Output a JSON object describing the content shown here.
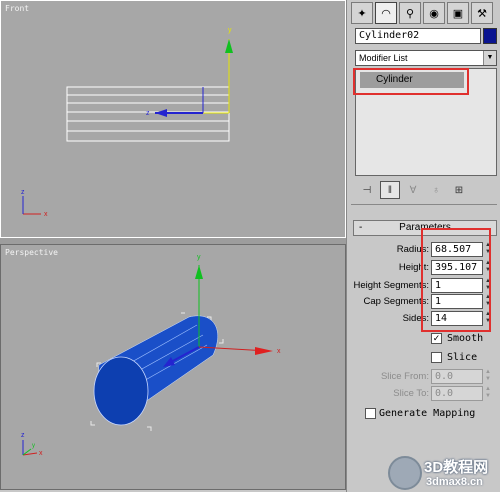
{
  "viewports": {
    "front": {
      "label": "Front"
    },
    "perspective": {
      "label": "Perspective"
    }
  },
  "axes": {
    "x": "x",
    "y": "y",
    "z": "z"
  },
  "panel": {
    "tabs": [
      {
        "name": "create-icon",
        "glyph": "✦"
      },
      {
        "name": "modify-icon",
        "glyph": "◠"
      },
      {
        "name": "hierarchy-icon",
        "glyph": "⚲"
      },
      {
        "name": "motion-icon",
        "glyph": "◉"
      },
      {
        "name": "display-icon",
        "glyph": "▣"
      },
      {
        "name": "utilities-icon",
        "glyph": "⚒"
      }
    ],
    "object_name": "Cylinder02",
    "object_color": "#0a1490",
    "modifier_list": "Modifier List",
    "stack_items": [
      "Cylinder"
    ],
    "highlight_color": "#e0302e"
  },
  "parameters": {
    "rollout_sign": "-",
    "title": "Parameters",
    "radius_label": "Radius:",
    "radius": "68.507",
    "height_label": "Height:",
    "height": "395.107",
    "height_segments_label": "Height Segments:",
    "height_segments": "1",
    "cap_segments_label": "Cap Segments:",
    "cap_segments": "1",
    "sides_label": "Sides:",
    "sides": "14",
    "smooth_label": "Smooth",
    "smooth": true,
    "slice_label": "Slice",
    "slice": false,
    "slice_from_label": "Slice From:",
    "slice_from": "0.0",
    "slice_to_label": "Slice To:",
    "slice_to": "0.0",
    "gen_mapping_label": "Generate Mapping",
    "gen_mapping": false
  },
  "watermark": {
    "line1": "3D教程网",
    "line2": "3dmax8.cn"
  }
}
